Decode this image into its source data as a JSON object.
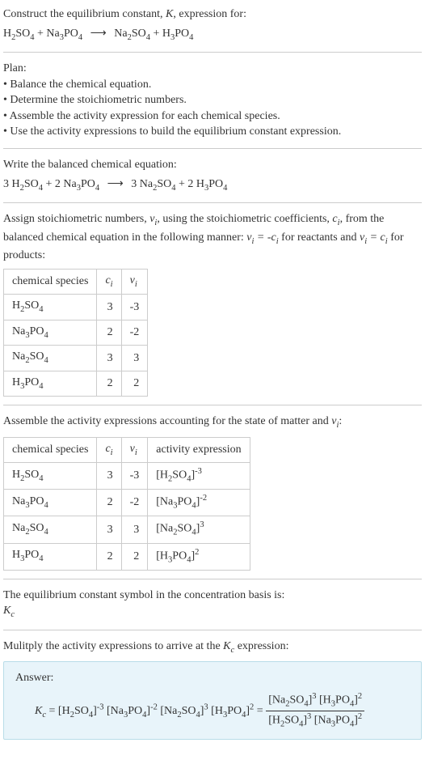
{
  "intro": {
    "line1": "Construct the equilibrium constant, K, expression for:",
    "reaction_lhs": "H₂SO₄ + Na₃PO₄",
    "reaction_rhs": "Na₂SO₄ + H₃PO₄"
  },
  "plan": {
    "header": "Plan:",
    "items": [
      "• Balance the chemical equation.",
      "• Determine the stoichiometric numbers.",
      "• Assemble the activity expression for each chemical species.",
      "• Use the activity expressions to build the equilibrium constant expression."
    ]
  },
  "balanced": {
    "header": "Write the balanced chemical equation:",
    "lhs": "3 H₂SO₄ + 2 Na₃PO₄",
    "rhs": "3 Na₂SO₄ + 2 H₃PO₄"
  },
  "stoich_text": {
    "part1": "Assign stoichiometric numbers, ",
    "nu": "νᵢ",
    "part2": ", using the stoichiometric coefficients, ",
    "ci": "cᵢ",
    "part3": ", from the balanced chemical equation in the following manner: ",
    "rel1": "νᵢ = -cᵢ",
    "part4": " for reactants and ",
    "rel2": "νᵢ = cᵢ",
    "part5": " for products:"
  },
  "table1": {
    "headers": [
      "chemical species",
      "cᵢ",
      "νᵢ"
    ],
    "rows": [
      [
        "H₂SO₄",
        "3",
        "-3"
      ],
      [
        "Na₃PO₄",
        "2",
        "-2"
      ],
      [
        "Na₂SO₄",
        "3",
        "3"
      ],
      [
        "H₃PO₄",
        "2",
        "2"
      ]
    ]
  },
  "activity_header": "Assemble the activity expressions accounting for the state of matter and νᵢ:",
  "table2": {
    "headers": [
      "chemical species",
      "cᵢ",
      "νᵢ",
      "activity expression"
    ],
    "rows": [
      [
        "H₂SO₄",
        "3",
        "-3",
        "[H₂SO₄]⁻³"
      ],
      [
        "Na₃PO₄",
        "2",
        "-2",
        "[Na₃PO₄]⁻²"
      ],
      [
        "Na₂SO₄",
        "3",
        "3",
        "[Na₂SO₄]³"
      ],
      [
        "H₃PO₄",
        "2",
        "2",
        "[H₃PO₄]²"
      ]
    ]
  },
  "kc_basis": {
    "line1": "The equilibrium constant symbol in the concentration basis is:",
    "symbol": "K_c"
  },
  "multiply_header": "Mulitply the activity expressions to arrive at the K_c expression:",
  "answer": {
    "label": "Answer:",
    "lhs": "K_c = [H₂SO₄]⁻³ [Na₃PO₄]⁻² [Na₂SO₄]³ [H₃PO₄]² = ",
    "frac_num": "[Na₂SO₄]³ [H₃PO₄]²",
    "frac_den": "[H₂SO₄]³ [Na₃PO₄]²"
  },
  "chart_data": {
    "type": "table",
    "tables": [
      {
        "title": "Stoichiometric numbers",
        "columns": [
          "chemical species",
          "c_i",
          "nu_i"
        ],
        "rows": [
          {
            "chemical species": "H2SO4",
            "c_i": 3,
            "nu_i": -3
          },
          {
            "chemical species": "Na3PO4",
            "c_i": 2,
            "nu_i": -2
          },
          {
            "chemical species": "Na2SO4",
            "c_i": 3,
            "nu_i": 3
          },
          {
            "chemical species": "H3PO4",
            "c_i": 2,
            "nu_i": 2
          }
        ]
      },
      {
        "title": "Activity expressions",
        "columns": [
          "chemical species",
          "c_i",
          "nu_i",
          "activity expression"
        ],
        "rows": [
          {
            "chemical species": "H2SO4",
            "c_i": 3,
            "nu_i": -3,
            "activity expression": "[H2SO4]^-3"
          },
          {
            "chemical species": "Na3PO4",
            "c_i": 2,
            "nu_i": -2,
            "activity expression": "[Na3PO4]^-2"
          },
          {
            "chemical species": "Na2SO4",
            "c_i": 3,
            "nu_i": 3,
            "activity expression": "[Na2SO4]^3"
          },
          {
            "chemical species": "H3PO4",
            "c_i": 2,
            "nu_i": 2,
            "activity expression": "[H3PO4]^2"
          }
        ]
      }
    ],
    "equilibrium_constant": "K_c = [Na2SO4]^3 [H3PO4]^2 / ([H2SO4]^3 [Na3PO4]^2)"
  }
}
